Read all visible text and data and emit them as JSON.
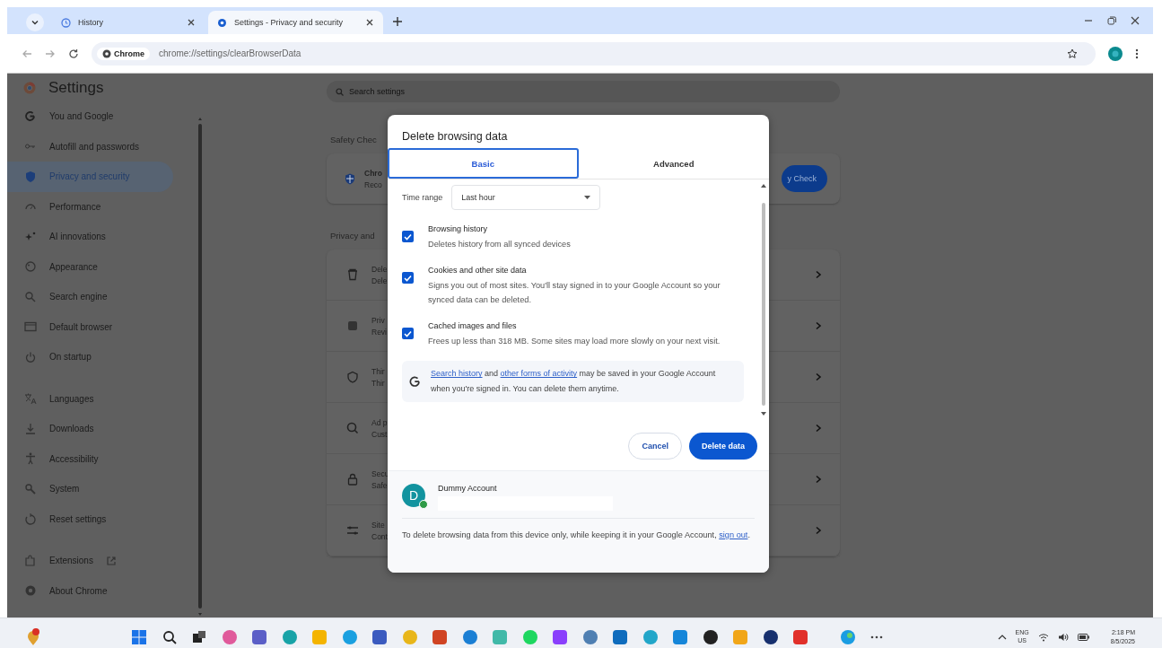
{
  "tabs": [
    {
      "title": "History",
      "selected": false
    },
    {
      "title": "Settings - Privacy and security",
      "selected": true
    }
  ],
  "address_bar": {
    "chip": "Chrome",
    "url": "chrome://settings/clearBrowserData"
  },
  "settings": {
    "title": "Settings",
    "nav_groups": [
      [
        {
          "label": "You and Google",
          "selected": false,
          "kind": "page"
        },
        {
          "label": "Autofill and passwords",
          "selected": false,
          "kind": "page"
        },
        {
          "label": "Privacy and security",
          "selected": true,
          "kind": "page"
        },
        {
          "label": "Performance",
          "selected": false,
          "kind": "page"
        },
        {
          "label": "AI innovations",
          "selected": false,
          "kind": "page"
        },
        {
          "label": "Appearance",
          "selected": false,
          "kind": "page"
        },
        {
          "label": "Search engine",
          "selected": false,
          "kind": "page"
        },
        {
          "label": "Default browser",
          "selected": false,
          "kind": "page"
        },
        {
          "label": "On startup",
          "selected": false,
          "kind": "page"
        }
      ],
      [
        {
          "label": "Languages",
          "selected": false,
          "kind": "page"
        },
        {
          "label": "Downloads",
          "selected": false,
          "kind": "page"
        },
        {
          "label": "Accessibility",
          "selected": false,
          "kind": "page"
        },
        {
          "label": "System",
          "selected": false,
          "kind": "page"
        },
        {
          "label": "Reset settings",
          "selected": false,
          "kind": "page"
        }
      ],
      [
        {
          "label": "Extensions",
          "selected": false,
          "kind": "external"
        },
        {
          "label": "About Chrome",
          "selected": false,
          "kind": "page"
        }
      ]
    ],
    "search": {
      "placeholder": "Search settings"
    },
    "safety_check": {
      "heading": "Safety Chec",
      "item_title": "Chro",
      "item_subtitle": "Reco",
      "button": "y Check"
    },
    "privacy": {
      "heading": "Privacy and",
      "rows": [
        {
          "title": "Dele",
          "subtitle": "Dele"
        },
        {
          "title": "Priv",
          "subtitle": "Revi"
        },
        {
          "title": "Thir",
          "subtitle": "Thir"
        },
        {
          "title": "Ad p",
          "subtitle": "Cust"
        },
        {
          "title": "Secu",
          "subtitle": "Safe"
        },
        {
          "title": "Site",
          "subtitle": "Cont"
        }
      ]
    }
  },
  "dialog": {
    "title": "Delete browsing data",
    "tabs": [
      {
        "label": "Basic",
        "selected": true
      },
      {
        "label": "Advanced",
        "selected": false
      }
    ],
    "time_range": {
      "label": "Time range",
      "value": "Last hour"
    },
    "options": [
      {
        "title": "Browsing history",
        "description": "Deletes history from all synced devices",
        "checked": true
      },
      {
        "title": "Cookies and other site data",
        "description": "Signs you out of most sites. You'll stay signed in to your Google Account so your synced data can be deleted.",
        "checked": true
      },
      {
        "title": "Cached images and files",
        "description": "Frees up less than 318 MB. Some sites may load more slowly on your next visit.",
        "checked": true
      }
    ],
    "info": [
      {
        "kind": "link",
        "text": "Search history"
      },
      {
        "kind": "text",
        "text": " and "
      },
      {
        "kind": "link",
        "text": "other forms of activity"
      },
      {
        "kind": "text",
        "text": " may be saved in your Google Account when you're signed in. You can delete them anytime."
      }
    ],
    "buttons": {
      "cancel": "Cancel",
      "confirm": "Delete data"
    },
    "account": {
      "initial": "D",
      "name": "Dummy Account"
    },
    "footer": [
      {
        "kind": "text",
        "text": "To delete browsing data from this device only, while keeping it in your Google Account, "
      },
      {
        "kind": "link",
        "text": "sign out"
      },
      {
        "kind": "text",
        "text": "."
      }
    ]
  },
  "taskbar": {
    "language": "ENG",
    "region": "US",
    "time": "2:18 PM",
    "date": "8/5/2025"
  }
}
